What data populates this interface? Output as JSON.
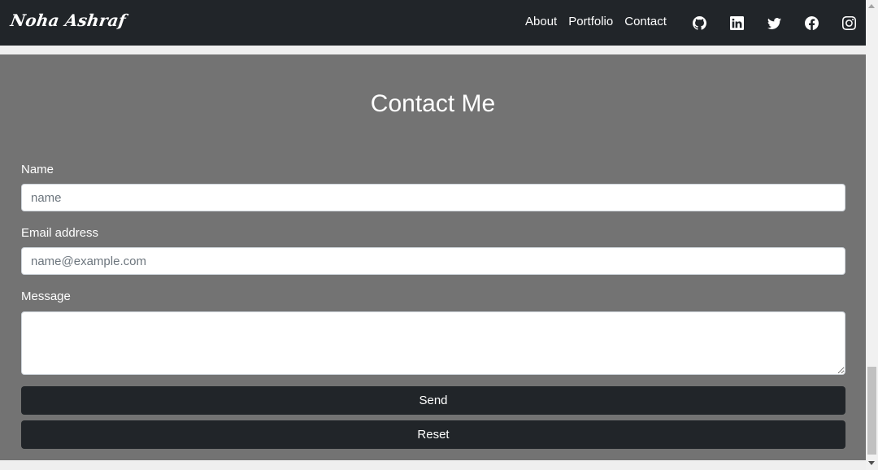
{
  "navbar": {
    "brand": "Noha Ashraf",
    "links": [
      "About",
      "Portfolio",
      "Contact"
    ],
    "socials": [
      "github-icon",
      "linkedin-icon",
      "twitter-icon",
      "facebook-icon",
      "instagram-icon"
    ]
  },
  "contact": {
    "title": "Contact Me",
    "name_label": "Name",
    "name_placeholder": "name",
    "email_label": "Email address",
    "email_placeholder": "name@example.com",
    "message_label": "Message",
    "send_label": "Send",
    "reset_label": "Reset"
  },
  "colors": {
    "navbar_bg": "#212529",
    "section_bg": "#737373",
    "button_bg": "#212529"
  }
}
